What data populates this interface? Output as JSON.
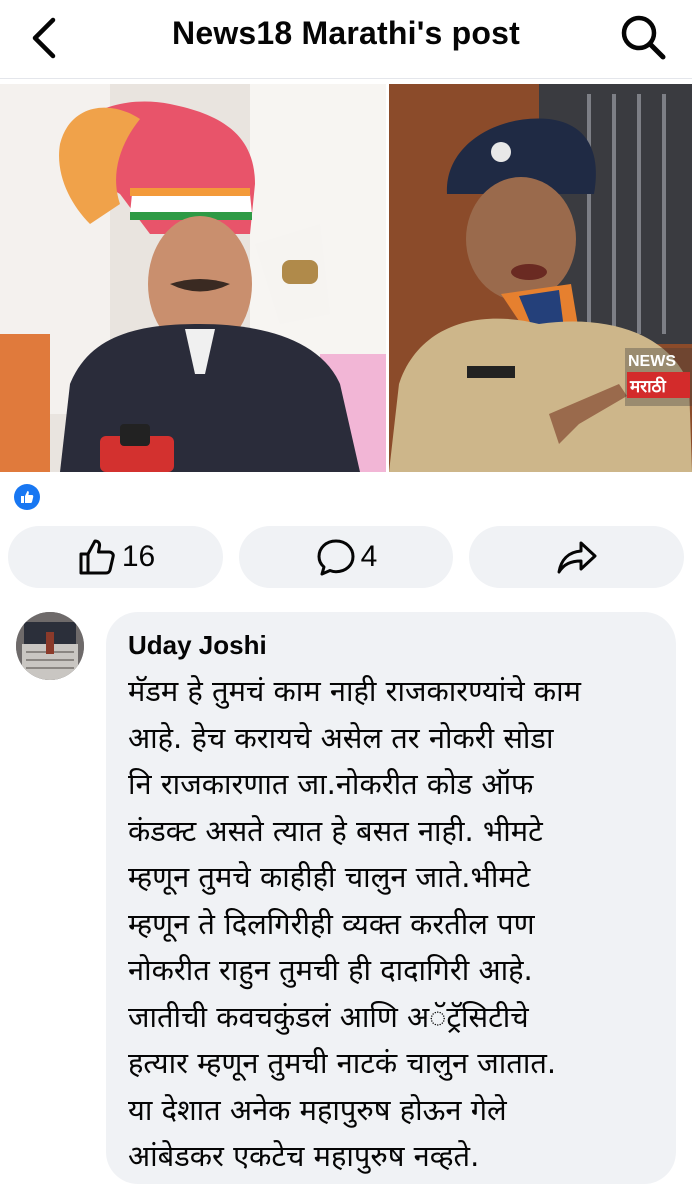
{
  "header": {
    "title": "News18 Marathi's post"
  },
  "post": {
    "image": {
      "watermark_line1": "NEWS",
      "watermark_line2": "मराठी"
    },
    "reactions": {
      "like_icon": "thumbs-up-icon",
      "like_count": "16",
      "comment_icon": "comment-bubble-icon",
      "comment_count": "4",
      "share_icon": "share-arrow-icon"
    }
  },
  "comment": {
    "author": "Uday Joshi",
    "lines": [
      "मॅडम हे तुमचं काम नाही राजकारण्यांचे काम",
      "आहे. हेच करायचे असेल तर नोकरी सोडा",
      "नि राजकारणात जा.नोकरीत कोड ऑफ",
      "कंडक्ट असते त्यात हे बसत नाही. भीमटे",
      "म्हणून तुमचे काहीही चालुन जाते.भीमटे",
      "म्हणून ते दिलगिरीही व्यक्त करतील पण",
      "नोकरीत राहुन तुमची ही दादागिरी आहे.",
      "जातीची कवचकुंडलं आणि अॅट्रॅसिटीचे",
      "हत्यार म्हणून तुमची नाटकं चालुन जातात.",
      "या देशात अनेक महापुरुष होऊन गेले",
      "आंबेडकर एकटेच महापुरुष नव्हते."
    ]
  },
  "colors": {
    "accent": "#1877f2",
    "button_bg": "#f0f2f5",
    "text": "#050505"
  }
}
